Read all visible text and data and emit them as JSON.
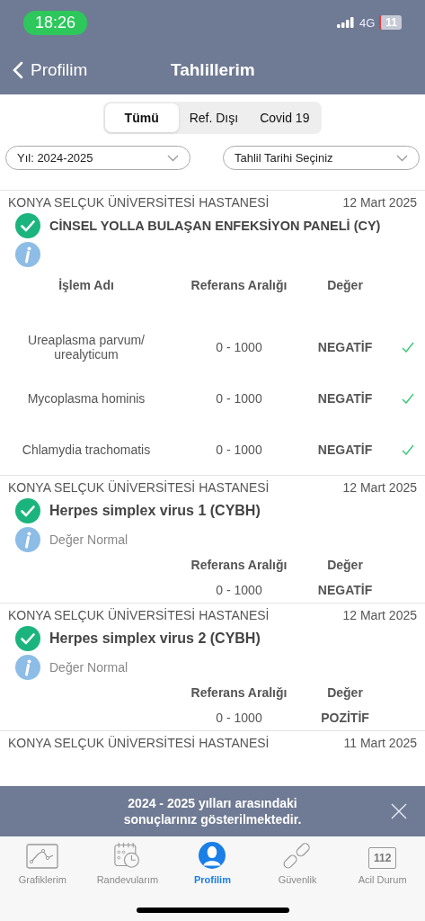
{
  "status_bar": {
    "time": "18:26",
    "network": "4G",
    "battery": "11"
  },
  "nav": {
    "back": "Profilim",
    "title": "Tahlillerim"
  },
  "segments": [
    {
      "label": "Tümü",
      "selected": true
    },
    {
      "label": "Ref. Dışı",
      "selected": false
    },
    {
      "label": "Covid 19",
      "selected": false
    }
  ],
  "filters": [
    {
      "value": "Yıl: 2024-2025"
    },
    {
      "value": "Tahlil Tarihi Seçiniz"
    }
  ],
  "results": [
    {
      "kind": "panel",
      "hospital": "KONYA SELÇUK ÜNİVERSİTESİ  HASTANESİ",
      "date": "12 Mart 2025",
      "title": "CİNSEL YOLLA BULAŞAN ENFEKSİYON PANELİ (CY)",
      "columns": [
        "İşlem Adı",
        "Referans Aralığı",
        "Değer"
      ],
      "rows": [
        {
          "name": "Ureaplasma parvum/ urealyticum",
          "range": "0 - 1000",
          "value": "NEGATİF",
          "checked": true
        },
        {
          "name": "Mycoplasma hominis",
          "range": "0 - 1000",
          "value": "NEGATİF",
          "checked": true
        },
        {
          "name": "Chlamydia trachomatis",
          "range": "0 - 1000",
          "value": "NEGATİF",
          "checked": true
        }
      ]
    },
    {
      "kind": "single",
      "hospital": "KONYA SELÇUK ÜNİVERSİTESİ  HASTANESİ",
      "date": "12 Mart 2025",
      "title": "Herpes simplex virus 1 (CYBH)",
      "note": "Değer Normal",
      "columns": [
        "Referans Aralığı",
        "Değer"
      ],
      "rows": [
        {
          "range": "0 - 1000",
          "value": "NEGATİF"
        }
      ]
    },
    {
      "kind": "single",
      "hospital": "KONYA SELÇUK ÜNİVERSİTESİ  HASTANESİ",
      "date": "12 Mart 2025",
      "title": "Herpes simplex virus 2 (CYBH)",
      "note": "Değer Normal",
      "columns": [
        "Referans Aralığı",
        "Değer"
      ],
      "rows": [
        {
          "range": "0 - 1000",
          "value": "POZİTİF"
        }
      ]
    },
    {
      "kind": "partial",
      "hospital": "KONYA SELÇUK ÜNİVERSİTESİ  HASTANESİ",
      "date": "11 Mart 2025"
    }
  ],
  "banner": {
    "text": "2024 - 2025 yılları arasındaki sonuçlarınız gösterilmektedir."
  },
  "tab_bar": [
    {
      "kind": "chart",
      "label": "Grafiklerim",
      "selected": false
    },
    {
      "kind": "calendar",
      "label": "Randevularım",
      "selected": false
    },
    {
      "kind": "person",
      "label": "Profilim",
      "selected": true
    },
    {
      "kind": "link",
      "label": "Güvenlik",
      "selected": false
    },
    {
      "kind": "emergency",
      "label": "Acil Durum",
      "code": "112",
      "selected": false
    }
  ]
}
